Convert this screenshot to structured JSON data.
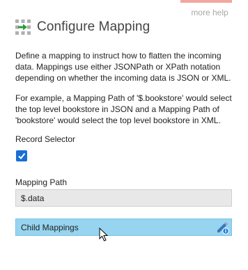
{
  "help": {
    "link_label": "more help"
  },
  "header": {
    "icon": "mapping-arrow-icon",
    "title": "Configure Mapping"
  },
  "description": {
    "p1": "Define a mapping to instruct how to flatten the incoming data. Mappings use either JSONPath or XPath notation depending on whether the incoming data is JSON or XML.",
    "p2": "For example, a Mapping Path of '$.bookstore' would select the top level bookstore in JSON and a Mapping Path of 'bookstore' would select the top level bookstore in XML."
  },
  "record_selector": {
    "label": "Record Selector",
    "checked": true
  },
  "mapping_path": {
    "label": "Mapping Path",
    "value": "$.data"
  },
  "child_mappings": {
    "label": "Child Mappings",
    "icon": "edit-pencil-icon"
  },
  "colors": {
    "accent": "#1a6fd4",
    "child_bar": "#96d4f0",
    "help_tab": "#f2a89e",
    "icon_green": "#2e9a3a"
  }
}
